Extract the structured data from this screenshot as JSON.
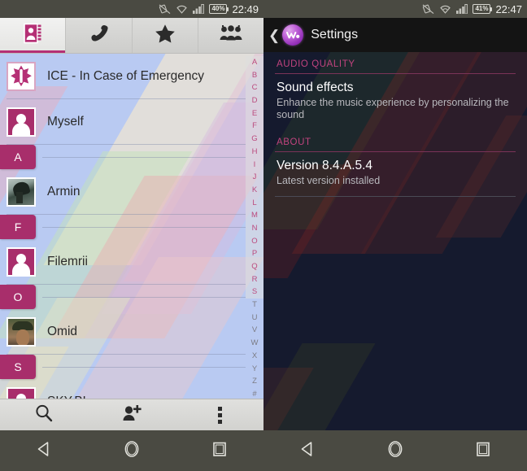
{
  "left_phone": {
    "status_bar": {
      "icons": [
        "screen-rotation-off-icon",
        "wifi-icon",
        "signal-icon"
      ],
      "battery_percent": "40%",
      "time": "22:49"
    },
    "app": "Contacts",
    "tabs": [
      {
        "id": "tab-contacts",
        "icon": "address-book-icon",
        "selected": true
      },
      {
        "id": "tab-dialer",
        "icon": "phone-handset-icon",
        "selected": false
      },
      {
        "id": "tab-favorites",
        "icon": "star-icon",
        "selected": false
      },
      {
        "id": "tab-groups",
        "icon": "people-group-icon",
        "selected": false
      }
    ],
    "list": [
      {
        "type": "contact",
        "name": "ICE - In Case of Emergency",
        "avatar": "emergency-star-icon"
      },
      {
        "type": "contact",
        "name": "Myself",
        "avatar": "default-person-icon"
      },
      {
        "type": "header",
        "label": "A"
      },
      {
        "type": "contact",
        "name": "Armin",
        "avatar": "photo-armin"
      },
      {
        "type": "header",
        "label": "F"
      },
      {
        "type": "contact",
        "name": "Filemrii",
        "avatar": "default-person-icon"
      },
      {
        "type": "header",
        "label": "O"
      },
      {
        "type": "contact",
        "name": "Omid",
        "avatar": "photo-omid"
      },
      {
        "type": "header",
        "label": "S"
      },
      {
        "type": "contact",
        "name": "SKY.BL",
        "avatar": "default-person-icon"
      }
    ],
    "alpha_index": {
      "letters": [
        "A",
        "B",
        "C",
        "D",
        "E",
        "F",
        "G",
        "H",
        "I",
        "J",
        "K",
        "L",
        "M",
        "N",
        "O",
        "P",
        "Q",
        "R",
        "S",
        "T",
        "U",
        "V",
        "W",
        "X",
        "Y",
        "Z",
        "#"
      ],
      "active_through": "S"
    },
    "bottom_bar": [
      {
        "id": "search-button",
        "icon": "search-icon"
      },
      {
        "id": "add-contact-button",
        "icon": "add-person-icon"
      },
      {
        "id": "overflow-menu-button",
        "icon": "overflow-menu-icon"
      }
    ],
    "accent_color": "#a82e6b",
    "background_color": "#b9caf2"
  },
  "right_phone": {
    "status_bar": {
      "icons": [
        "screen-rotation-off-icon",
        "wifi-icon",
        "signal-icon"
      ],
      "battery_percent": "41%",
      "time": "22:47"
    },
    "action_bar": {
      "back_icon": "back-chevron-icon",
      "app_icon": "walkman-logo-icon",
      "title": "Settings"
    },
    "sections": [
      {
        "header": "AUDIO QUALITY",
        "items": [
          {
            "title": "Sound effects",
            "subtitle": "Enhance the music experience by personalizing the sound"
          }
        ]
      },
      {
        "header": "ABOUT",
        "items": [
          {
            "title": "Version 8.4.A.5.4",
            "subtitle": "Latest version installed"
          }
        ]
      }
    ],
    "accent_color": "#c0437e",
    "background_color": "#151a2e"
  },
  "nav_bar": {
    "buttons": [
      {
        "id": "nav-back",
        "icon": "back-triangle-icon"
      },
      {
        "id": "nav-home",
        "icon": "home-circle-icon"
      },
      {
        "id": "nav-recents",
        "icon": "recents-square-icon"
      }
    ]
  }
}
